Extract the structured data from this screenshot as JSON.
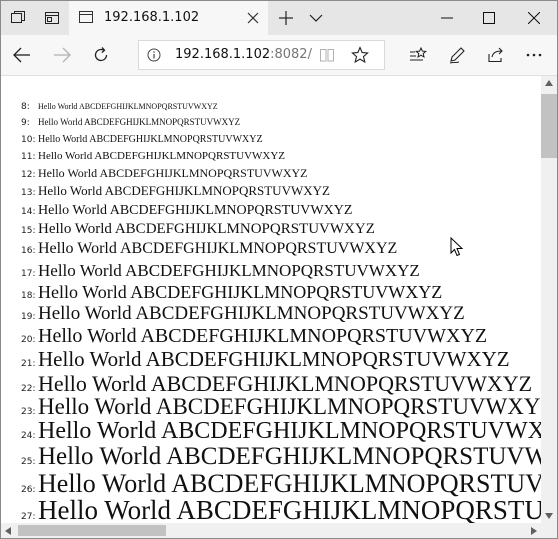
{
  "window": {
    "tab_title": "192.168.1.102"
  },
  "address_bar": {
    "host": "192.168.1.102",
    "port_path": ":8082/"
  },
  "content": {
    "sample_text": "Hello World ABCDEFGHIJKLMNOPQRSTUVWXYZ",
    "lines": [
      {
        "label": "8:",
        "size": 8
      },
      {
        "label": "9:",
        "size": 9
      },
      {
        "label": "10:",
        "size": 10
      },
      {
        "label": "11:",
        "size": 11
      },
      {
        "label": "12:",
        "size": 12
      },
      {
        "label": "13:",
        "size": 13
      },
      {
        "label": "14:",
        "size": 14
      },
      {
        "label": "15:",
        "size": 15
      },
      {
        "label": "16:",
        "size": 16
      },
      {
        "label": "17:",
        "size": 17
      },
      {
        "label": "18:",
        "size": 18
      },
      {
        "label": "19:",
        "size": 19
      },
      {
        "label": "20:",
        "size": 20
      },
      {
        "label": "21:",
        "size": 21
      },
      {
        "label": "22:",
        "size": 22
      },
      {
        "label": "23:",
        "size": 23
      },
      {
        "label": "24:",
        "size": 24
      },
      {
        "label": "25:",
        "size": 25
      },
      {
        "label": "26:",
        "size": 26
      },
      {
        "label": "27:",
        "size": 27
      }
    ]
  },
  "icons": {
    "tab_actions": "tab-stack-icon",
    "tab_preview": "tab-preview-icon",
    "new_tab": "plus-icon",
    "tab_list": "chevron-down-icon",
    "back": "arrow-left-icon",
    "forward": "arrow-right-icon",
    "refresh": "refresh-icon",
    "site_info": "info-icon",
    "reading_view": "book-icon",
    "favorite": "star-icon",
    "favorites_hub": "favorites-list-icon",
    "notes": "pen-icon",
    "share": "share-icon"
  }
}
